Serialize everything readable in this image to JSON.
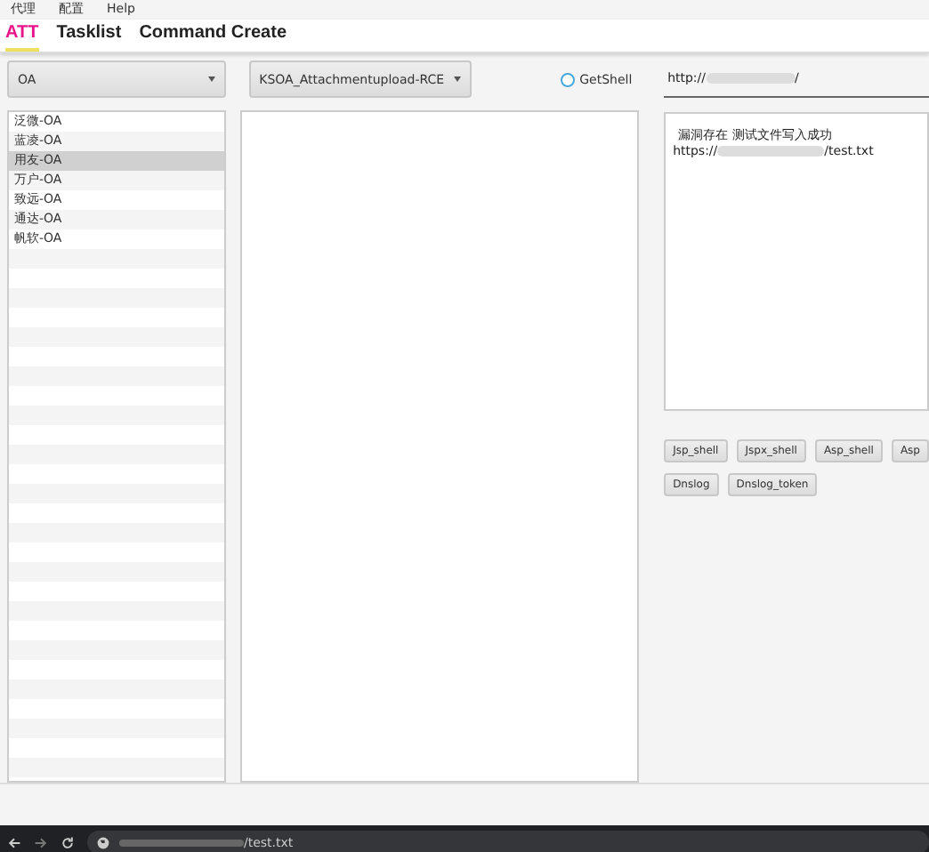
{
  "menu": [
    "代理",
    "配置",
    "Help"
  ],
  "tabs": [
    {
      "label": "ATT",
      "selected": true
    },
    {
      "label": "Tasklist",
      "selected": false
    },
    {
      "label": "Command Create",
      "selected": false
    }
  ],
  "category_select": {
    "value": "OA"
  },
  "vendors": [
    {
      "label": "泛微-OA",
      "selected": false
    },
    {
      "label": "蓝凌-OA",
      "selected": false
    },
    {
      "label": "用友-OA",
      "selected": true
    },
    {
      "label": "万户-OA",
      "selected": false
    },
    {
      "label": "致远-OA",
      "selected": false
    },
    {
      "label": "通达-OA",
      "selected": false
    },
    {
      "label": "帆软-OA",
      "selected": false
    }
  ],
  "exploit_select": {
    "value": "KSOA_Attachmentupload-RCE"
  },
  "getshell": {
    "label": "GetShell",
    "checked": false
  },
  "url": {
    "prefix": "http://",
    "suffix": "/"
  },
  "output": {
    "line_1": "漏洞存在 测试文件写入成功",
    "line_2_prefix": "https://",
    "line_2_suffix": "/test.txt"
  },
  "buttons": [
    [
      "Jsp_shell",
      "Jspx_shell",
      "Asp_shell",
      "Asp"
    ],
    [
      "Dnslog",
      "Dnslog_token"
    ]
  ],
  "browser_bar": {
    "url_suffix": "/test.txt"
  }
}
